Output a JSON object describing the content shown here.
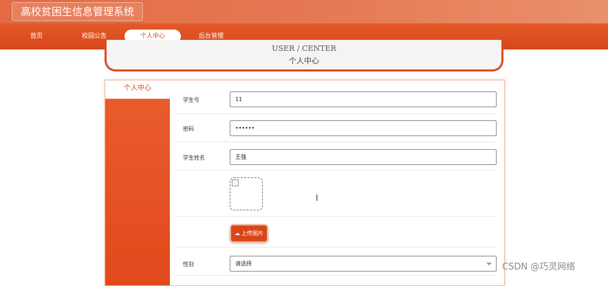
{
  "app": {
    "title": "高校贫困生信息管理系统"
  },
  "nav": {
    "items": [
      {
        "label": "首页"
      },
      {
        "label": "校园公告"
      },
      {
        "label": "个人中心"
      },
      {
        "label": "后台管理"
      }
    ],
    "active": "个人中心"
  },
  "hero": {
    "en": "USER / CENTER",
    "cn": "个人中心"
  },
  "sidebar": {
    "tab": "个人中心"
  },
  "form": {
    "student_no": {
      "label": "学生号",
      "value": "11"
    },
    "password": {
      "label": "密码",
      "value": "••••••"
    },
    "name": {
      "label": "学生姓名",
      "value": "王强"
    },
    "upload": {
      "label": "上传图片"
    },
    "gender": {
      "label": "性别",
      "placeholder": "请选择"
    }
  },
  "watermark": "CSDN @巧灵网络",
  "colors": {
    "brand": "#d9461a",
    "topbar": "#e57a54"
  }
}
